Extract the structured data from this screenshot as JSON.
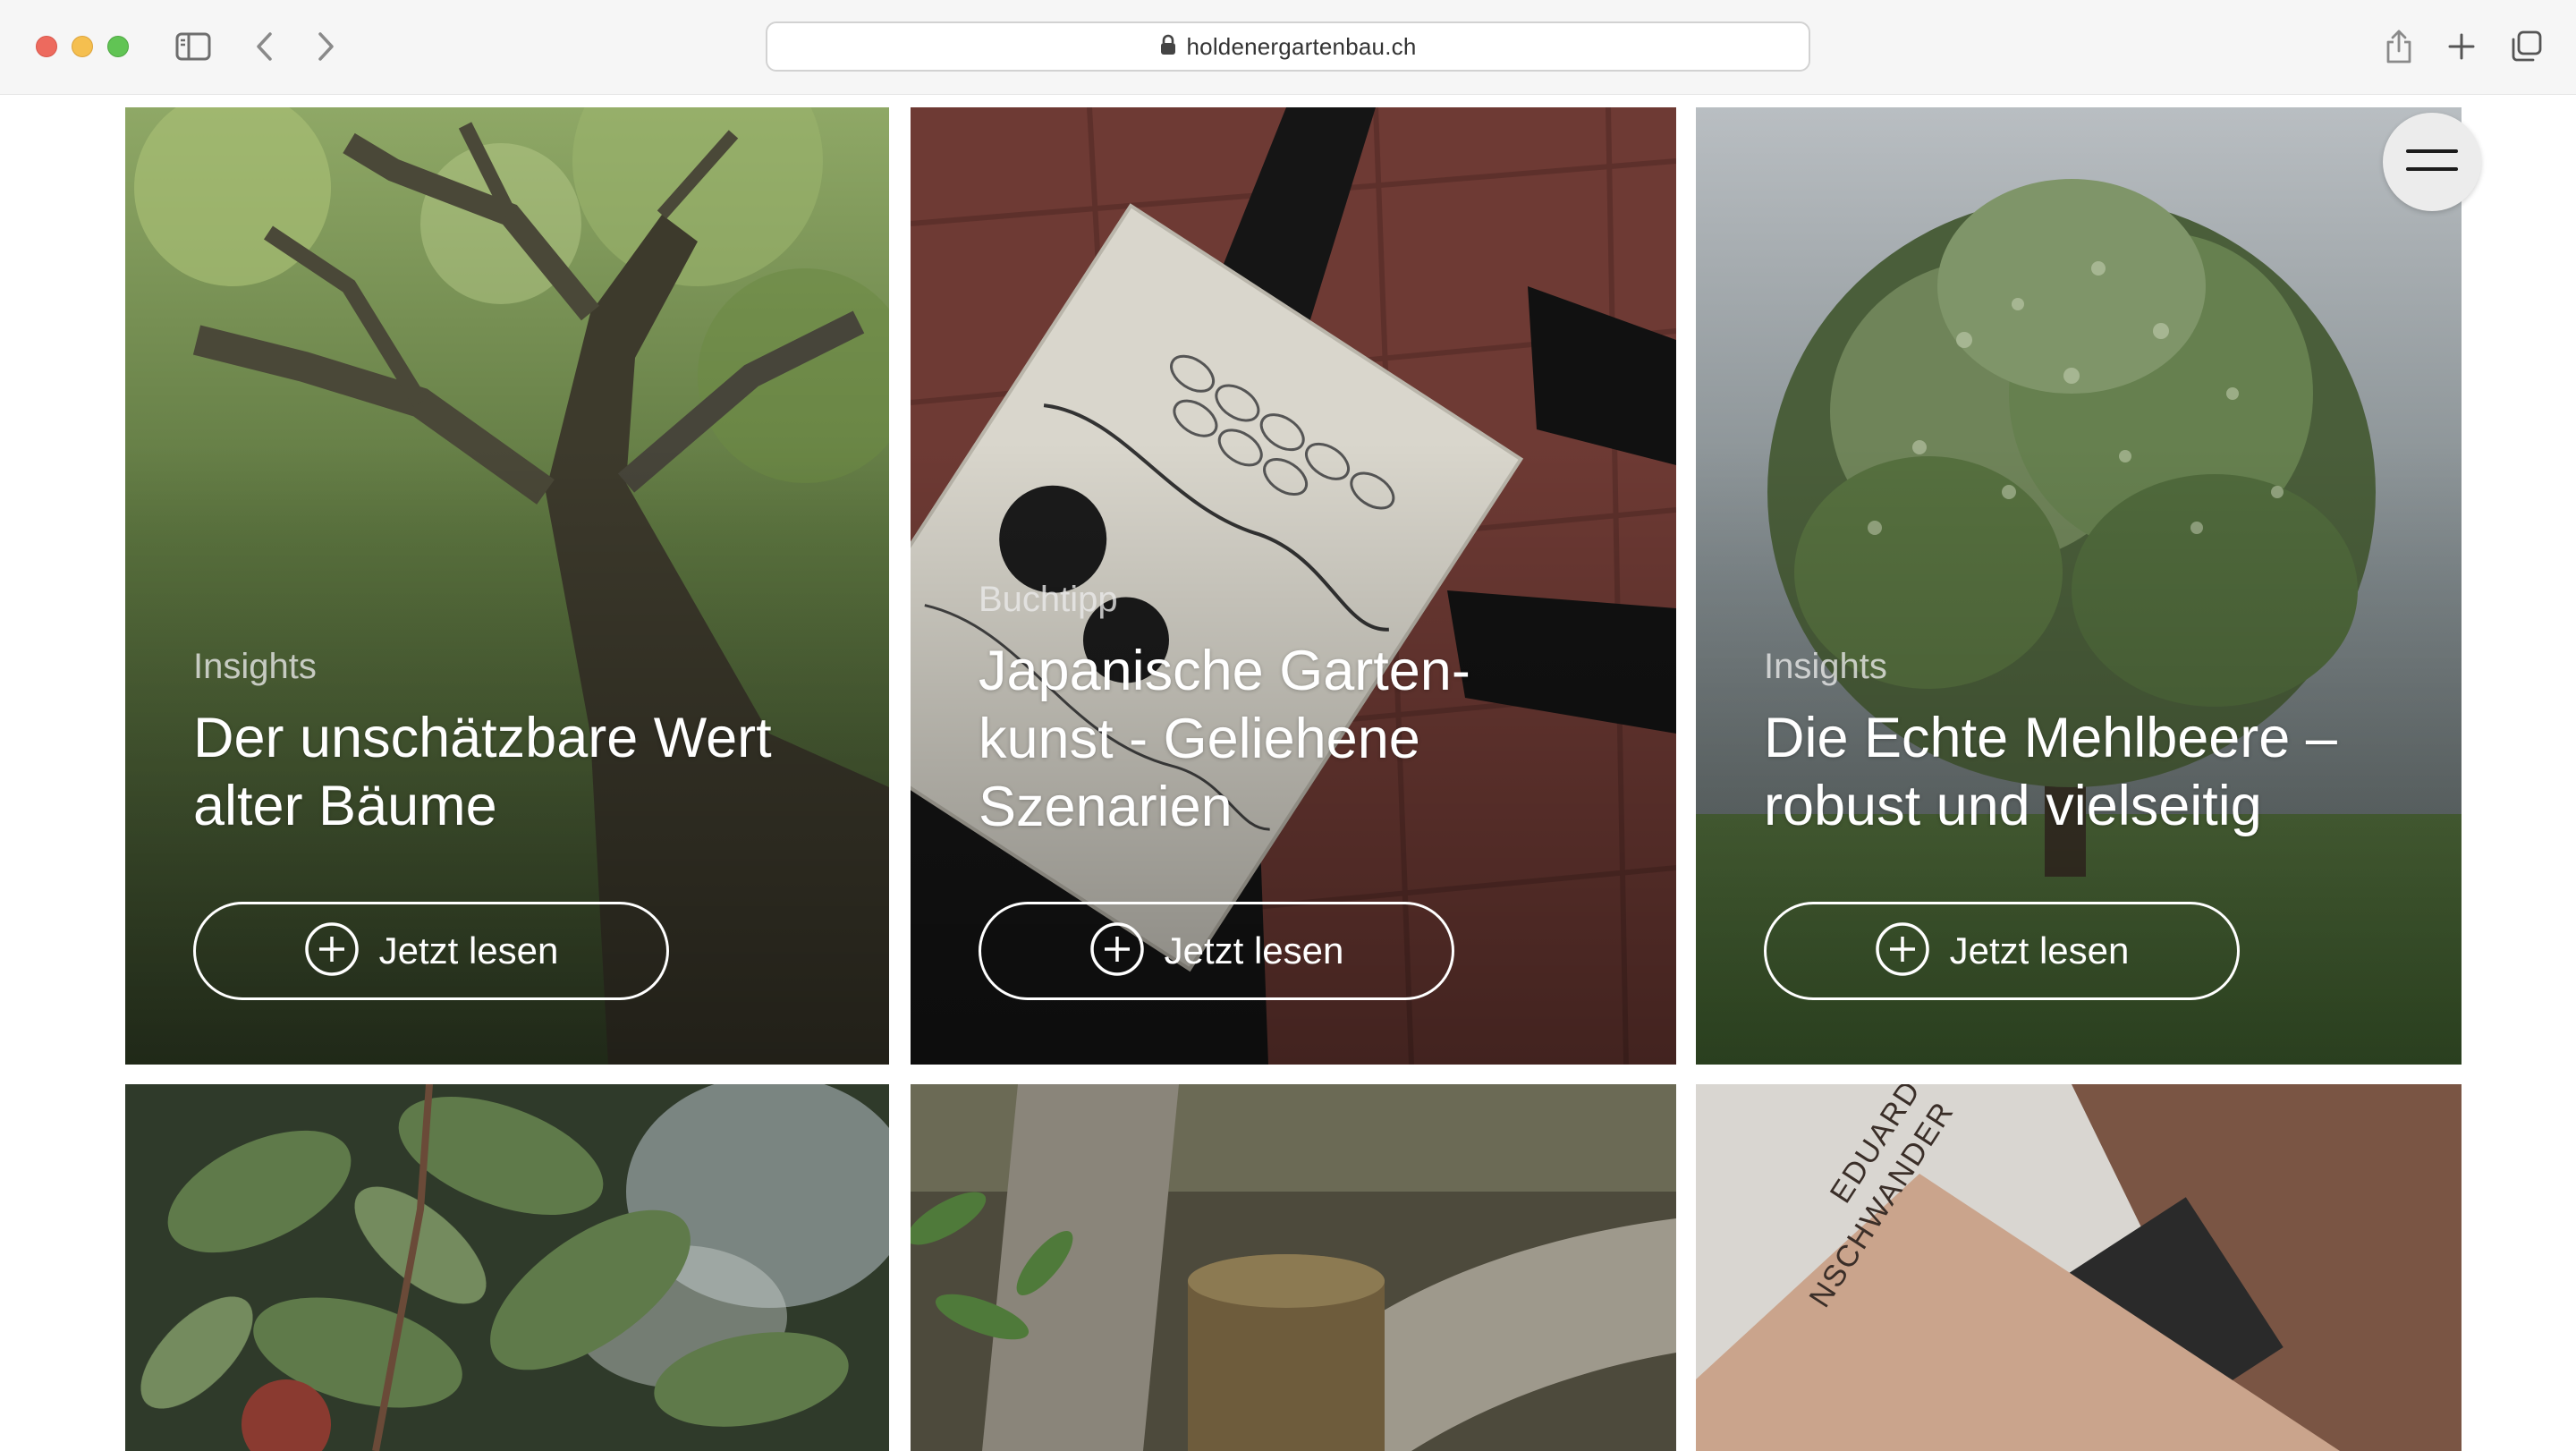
{
  "browser": {
    "url": "holdenergartenbau.ch"
  },
  "cards": [
    {
      "category": "Insights",
      "title_lines": [
        "Der unschätzbare Wert",
        "alter Bäume"
      ],
      "cta": "Jetzt lesen"
    },
    {
      "category": "Buchtipp",
      "title_lines": [
        "Japanische Garten-",
        "kunst - Geliehene",
        "Szenarien"
      ],
      "cta": "Jetzt lesen"
    },
    {
      "category": "Insights",
      "title_lines": [
        "Die Echte Mehlbeere –",
        "robust und vielseitig"
      ],
      "cta": "Jetzt lesen"
    }
  ],
  "lower_cards": {
    "book_cover_text": [
      "EDUARD",
      "NSCHWANDER"
    ]
  },
  "icons": {
    "lock": "lock-icon",
    "menu": "hamburger-menu-icon",
    "cta": "plus-circle-icon"
  },
  "colors": {
    "chrome_bg": "#f6f6f6",
    "page_bg": "#ffffff",
    "text_on_image": "#ffffff"
  }
}
